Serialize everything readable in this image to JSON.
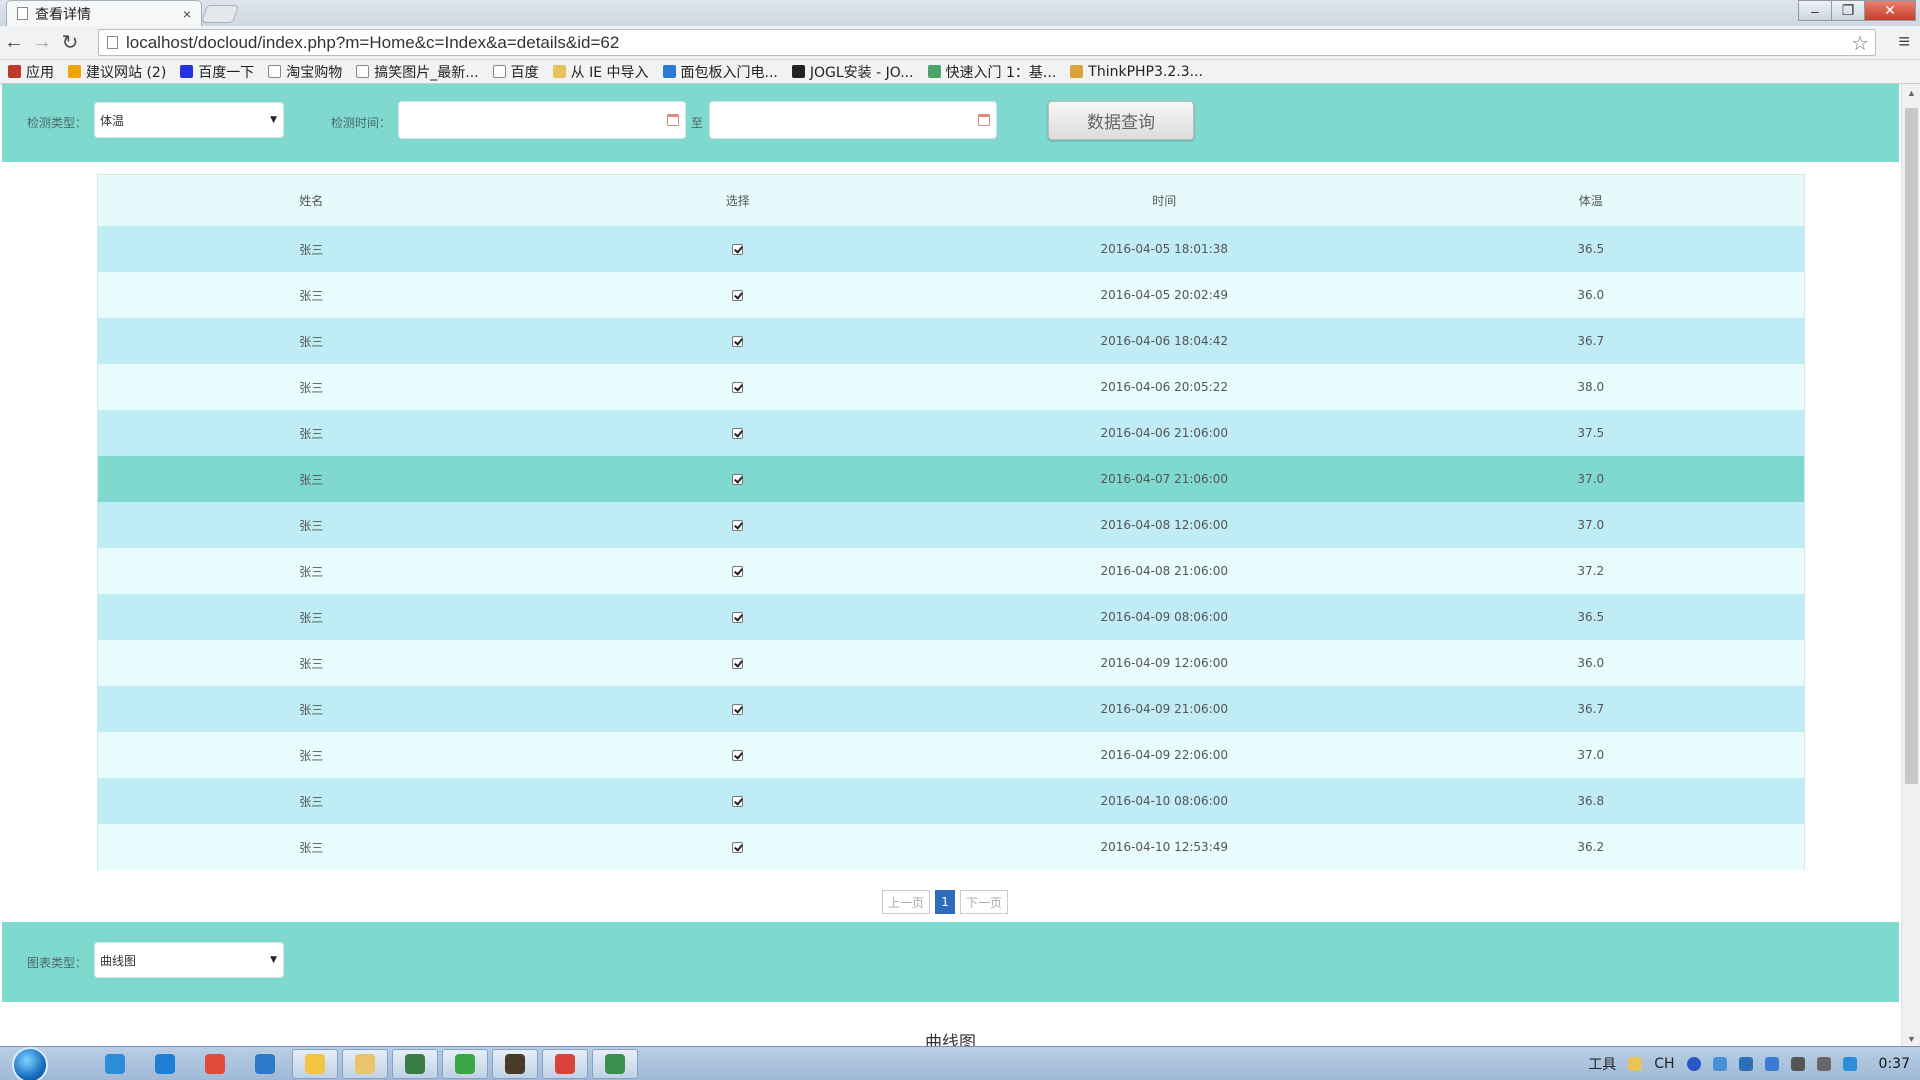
{
  "browser": {
    "tab_title": "查看详情",
    "tab_close": "×",
    "url": "localhost/docloud/index.php?m=Home&c=Index&a=details&id=62",
    "bookmarks": [
      {
        "label": "应用",
        "icon": "apps-grid-icon",
        "color": "#c0392b"
      },
      {
        "label": "建议网站 (2)",
        "icon": "bing-icon",
        "color": "#f0a30a"
      },
      {
        "label": "百度一下",
        "icon": "baidu-paw-icon",
        "color": "#2932e1"
      },
      {
        "label": "淘宝购物",
        "icon": "page-icon",
        "color": "#ffffff"
      },
      {
        "label": "搞笑图片_最新...",
        "icon": "page-icon",
        "color": "#ffffff"
      },
      {
        "label": "百度",
        "icon": "page-icon",
        "color": "#ffffff"
      },
      {
        "label": "从 IE 中导入",
        "icon": "folder-icon",
        "color": "#e8c35a"
      },
      {
        "label": "面包板入门电...",
        "icon": "circle-play-icon",
        "color": "#2a7ad6"
      },
      {
        "label": "JOGL安装 - JO...",
        "icon": "b-logo-icon",
        "color": "#222222"
      },
      {
        "label": "快速入门 1：基...",
        "icon": "cloud-icon",
        "color": "#4aa36b"
      },
      {
        "label": "ThinkPHP3.2.3...",
        "icon": "thinkphp-icon",
        "color": "#d9a53a"
      }
    ]
  },
  "filter": {
    "type_label": "检测类型：",
    "type_value": "体温",
    "time_label": "检测时间：",
    "to_label": "至",
    "query_button": "数据查询"
  },
  "table": {
    "headers": [
      "姓名",
      "选择",
      "时间",
      "体温"
    ],
    "rows": [
      {
        "name": "张三",
        "checked": true,
        "time": "2016-04-05 18:01:38",
        "temp": "36.5"
      },
      {
        "name": "张三",
        "checked": true,
        "time": "2016-04-05 20:02:49",
        "temp": "36.0"
      },
      {
        "name": "张三",
        "checked": true,
        "time": "2016-04-06 18:04:42",
        "temp": "36.7"
      },
      {
        "name": "张三",
        "checked": true,
        "time": "2016-04-06 20:05:22",
        "temp": "38.0"
      },
      {
        "name": "张三",
        "checked": true,
        "time": "2016-04-06 21:06:00",
        "temp": "37.5"
      },
      {
        "name": "张三",
        "checked": true,
        "time": "2016-04-07 21:06:00",
        "temp": "37.0"
      },
      {
        "name": "张三",
        "checked": true,
        "time": "2016-04-08 12:06:00",
        "temp": "37.0"
      },
      {
        "name": "张三",
        "checked": true,
        "time": "2016-04-08 21:06:00",
        "temp": "37.2"
      },
      {
        "name": "张三",
        "checked": true,
        "time": "2016-04-09 08:06:00",
        "temp": "36.5"
      },
      {
        "name": "张三",
        "checked": true,
        "time": "2016-04-09 12:06:00",
        "temp": "36.0"
      },
      {
        "name": "张三",
        "checked": true,
        "time": "2016-04-09 21:06:00",
        "temp": "36.7"
      },
      {
        "name": "张三",
        "checked": true,
        "time": "2016-04-09 22:06:00",
        "temp": "37.0"
      },
      {
        "name": "张三",
        "checked": true,
        "time": "2016-04-10 08:06:00",
        "temp": "36.8"
      },
      {
        "name": "张三",
        "checked": true,
        "time": "2016-04-10 12:53:49",
        "temp": "36.2"
      }
    ],
    "highlight_row": 5
  },
  "pager": {
    "prev": "上一页",
    "current": "1",
    "next": "下一页"
  },
  "chart_settings": {
    "type_label": "图表类型：",
    "type_value": "曲线图",
    "title": "曲线图"
  },
  "taskbar": {
    "apps": [
      {
        "icon": "qq-icon",
        "color": "#2a8fd8"
      },
      {
        "icon": "kugou-icon",
        "color": "#1e7fd6"
      },
      {
        "icon": "chrome-icon",
        "color": "#e24b3a"
      },
      {
        "icon": "browser-e-icon",
        "color": "#2c79c8"
      },
      {
        "icon": "note-app-icon",
        "color": "#f4c542"
      },
      {
        "icon": "explorer-folder-icon",
        "color": "#e9c46a"
      },
      {
        "icon": "network-app-icon",
        "color": "#3a7d44"
      },
      {
        "icon": "360-browser-icon",
        "color": "#39a845"
      },
      {
        "icon": "book-app-icon",
        "color": "#4a3a2a"
      },
      {
        "icon": "chart-app-icon",
        "color": "#d9433a"
      },
      {
        "icon": "pen-app-icon",
        "color": "#3c8f4f"
      }
    ],
    "tray_text": "工具",
    "ime": "CH",
    "clock": "0:37"
  },
  "colors": {
    "accent_teal": "#80d9cf",
    "row_odd": "#c0ecf5",
    "row_even": "#e8fbfd",
    "pager_active": "#2e6dbc"
  }
}
